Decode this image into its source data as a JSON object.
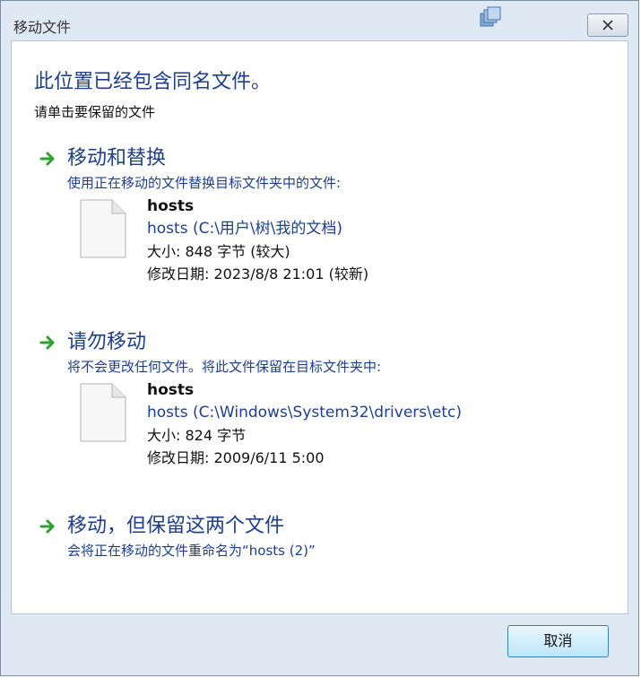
{
  "window": {
    "title": "移动文件"
  },
  "dialog": {
    "heading": "此位置已经包含同名文件。",
    "subheading": "请单击要保留的文件"
  },
  "options": [
    {
      "title": "移动和替换",
      "description": "使用正在移动的文件替换目标文件夹中的文件:",
      "file": {
        "name": "hosts",
        "path": "hosts (C:\\用户\\树\\我的文档)",
        "size": "大小: 848 字节 (较大)",
        "modified": "修改日期: 2023/8/8 21:01 (较新)"
      }
    },
    {
      "title": "请勿移动",
      "description": "将不会更改任何文件。将此文件保留在目标文件夹中:",
      "file": {
        "name": "hosts",
        "path": "hosts (C:\\Windows\\System32\\drivers\\etc)",
        "size": "大小: 824 字节",
        "modified": "修改日期: 2009/6/11 5:00"
      }
    },
    {
      "title": "移动，但保留这两个文件",
      "description": "会将正在移动的文件重命名为“hosts (2)”"
    }
  ],
  "footer": {
    "cancel_label": "取消"
  },
  "icons": {
    "arrow": "green-arrow-icon",
    "file": "document-icon",
    "window": "copy-windows-icon",
    "close": "close-icon"
  },
  "colors": {
    "link_blue": "#1e3f8c",
    "arrow_green": "#2ea02e",
    "frame": "#dfe9f4"
  }
}
